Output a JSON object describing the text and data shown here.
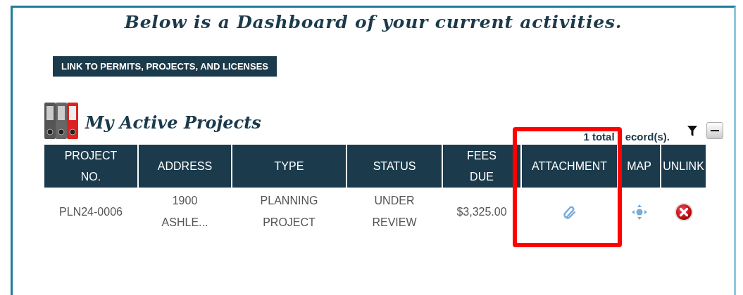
{
  "page": {
    "title": "Below is a Dashboard of your current activities."
  },
  "link_button": {
    "label": "LINK TO PERMITS, PROJECTS, AND LICENSES"
  },
  "section": {
    "title": "My Active Projects",
    "record_count": [
      "1 total",
      "ecord(s)."
    ],
    "expanded": true
  },
  "table": {
    "columns": [
      "PROJECT NO.",
      "ADDRESS",
      "TYPE",
      "STATUS",
      "FEES DUE",
      "ATTACHMENT",
      "MAP",
      "UNLINK"
    ],
    "rows": [
      {
        "cells": [
          {
            "kind": "text",
            "text": "PLN24-0006"
          },
          {
            "kind": "text",
            "text": "1900 ASHLE..."
          },
          {
            "kind": "text",
            "text": "PLANNING PROJECT"
          },
          {
            "kind": "text",
            "text": "UNDER REVIEW"
          },
          {
            "kind": "text",
            "text": "$3,325.00"
          },
          {
            "kind": "attachment"
          },
          {
            "kind": "map"
          },
          {
            "kind": "unlink"
          }
        ]
      }
    ]
  },
  "highlight": {
    "shown": true
  }
}
